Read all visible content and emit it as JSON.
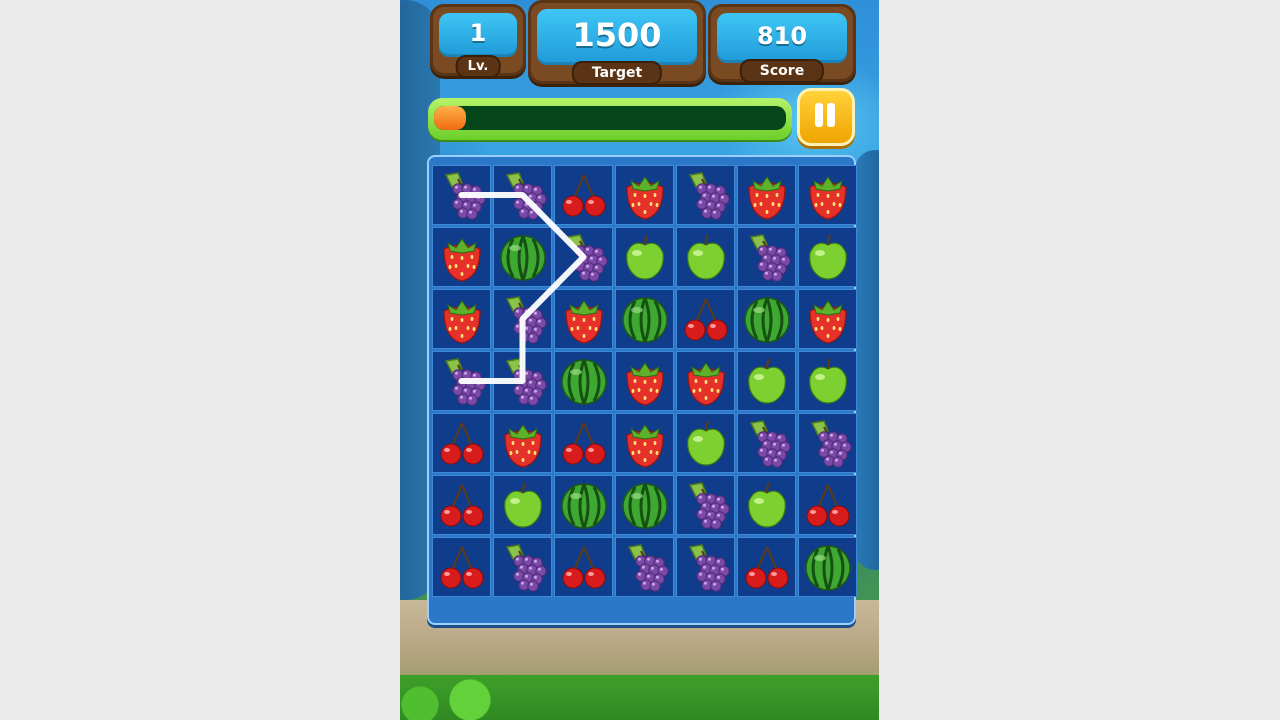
{
  "hud": {
    "level": {
      "value": "1",
      "label": "Lv."
    },
    "target": {
      "value": "1500",
      "label": "Target"
    },
    "score": {
      "value": "810",
      "label": "Score"
    }
  },
  "progress": {
    "fraction": 0.09
  },
  "colors": {
    "progress_fill": "#f07a18",
    "board": "#2b78c8",
    "cell": "#103c8c",
    "pause": "#f5b400"
  },
  "board": {
    "rows": [
      [
        "grape",
        "grape",
        "cherry",
        "strawberry",
        "grape",
        "strawberry",
        "strawberry"
      ],
      [
        "strawberry",
        "watermelon",
        "grape",
        "apple",
        "apple",
        "grape",
        "apple"
      ],
      [
        "strawberry",
        "grape",
        "strawberry",
        "watermelon",
        "cherry",
        "watermelon",
        "strawberry"
      ],
      [
        "grape",
        "grape",
        "watermelon",
        "strawberry",
        "strawberry",
        "apple",
        "apple"
      ],
      [
        "cherry",
        "strawberry",
        "cherry",
        "strawberry",
        "apple",
        "grape",
        "grape"
      ],
      [
        "cherry",
        "apple",
        "watermelon",
        "watermelon",
        "grape",
        "apple",
        "cherry"
      ],
      [
        "cherry",
        "grape",
        "cherry",
        "grape",
        "grape",
        "cherry",
        "watermelon"
      ]
    ],
    "selected_path": [
      [
        0,
        0
      ],
      [
        0,
        1
      ],
      [
        1,
        2
      ],
      [
        2,
        1
      ],
      [
        3,
        1
      ],
      [
        3,
        0
      ]
    ]
  }
}
